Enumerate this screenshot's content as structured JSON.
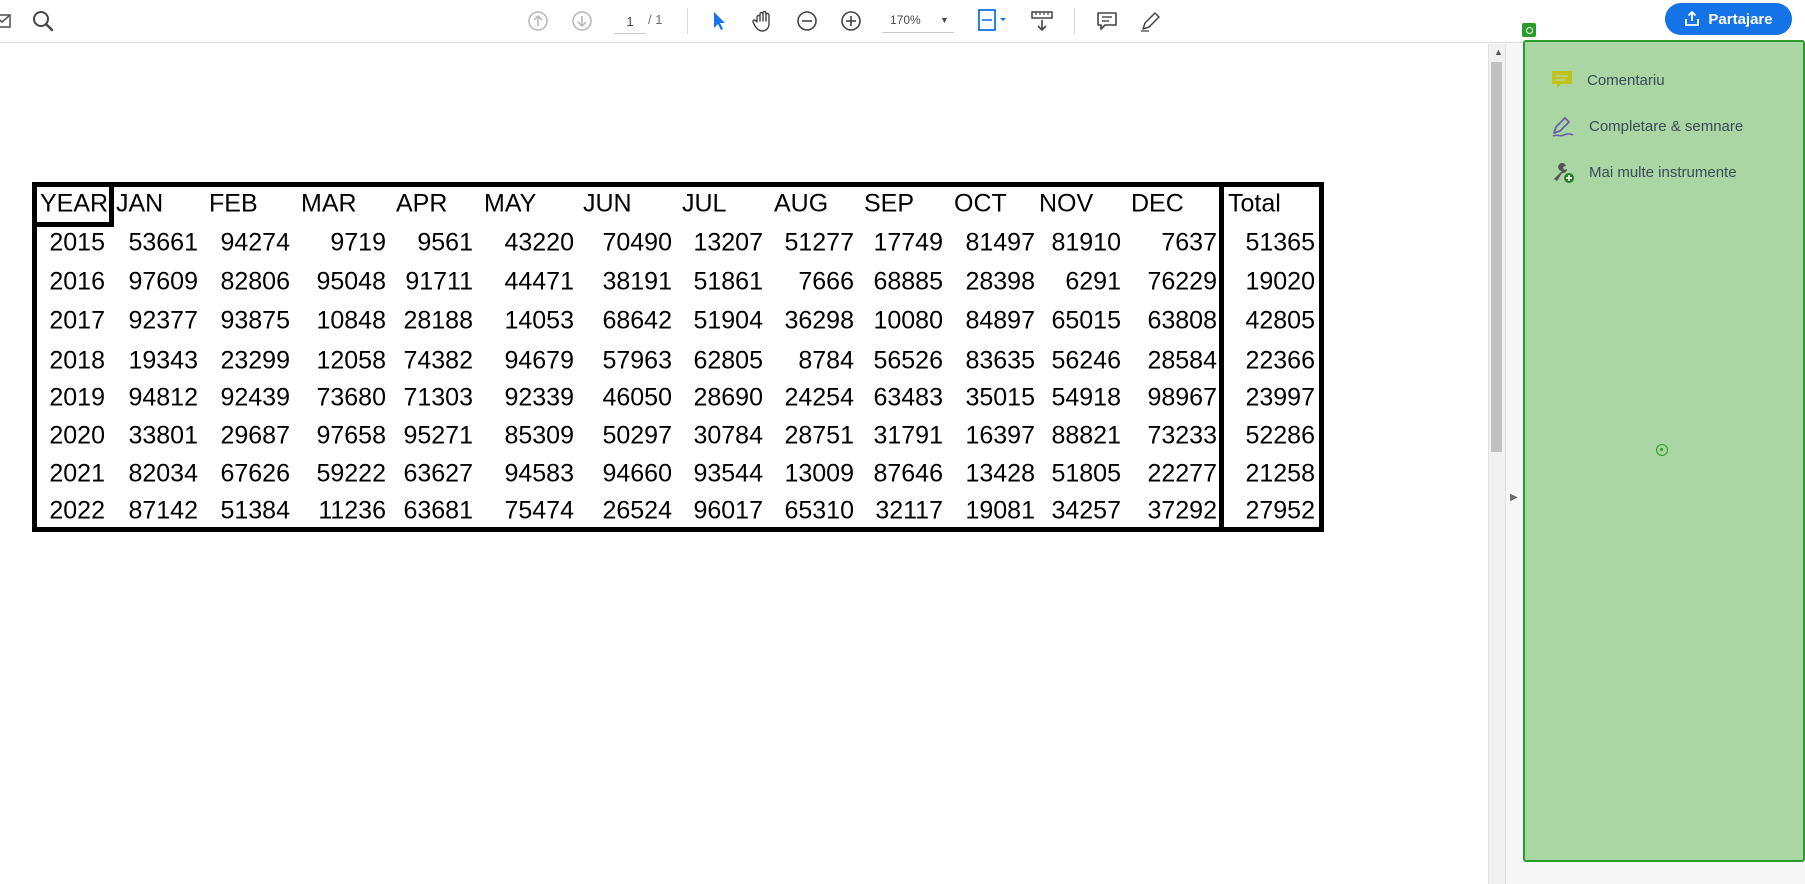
{
  "toolbar": {
    "page_current": "1",
    "page_total": "/ 1",
    "zoom": "170%",
    "share_label": "Partajare"
  },
  "table": {
    "headers": [
      "YEAR",
      "JAN",
      "FEB",
      "MAR",
      "APR",
      "MAY",
      "JUN",
      "JUL",
      "AUG",
      "SEP",
      "OCT",
      "NOV",
      "DEC",
      "Total"
    ],
    "rows": [
      [
        "2015",
        "53661",
        "94274",
        "9719",
        "9561",
        "43220",
        "70490",
        "13207",
        "51277",
        "17749",
        "81497",
        "81910",
        "7637",
        "51365"
      ],
      [
        "2016",
        "97609",
        "82806",
        "95048",
        "91711",
        "44471",
        "38191",
        "51861",
        "7666",
        "68885",
        "28398",
        "6291",
        "76229",
        "19020"
      ],
      [
        "2017",
        "92377",
        "93875",
        "10848",
        "28188",
        "14053",
        "68642",
        "51904",
        "36298",
        "10080",
        "84897",
        "65015",
        "63808",
        "42805"
      ],
      [
        "2018",
        "19343",
        "23299",
        "12058",
        "74382",
        "94679",
        "57963",
        "62805",
        "8784",
        "56526",
        "83635",
        "56246",
        "28584",
        "22366"
      ],
      [
        "2019",
        "94812",
        "92439",
        "73680",
        "71303",
        "92339",
        "46050",
        "28690",
        "24254",
        "63483",
        "35015",
        "54918",
        "98967",
        "23997"
      ],
      [
        "2020",
        "33801",
        "29687",
        "97658",
        "95271",
        "85309",
        "50297",
        "30784",
        "28751",
        "31791",
        "16397",
        "88821",
        "73233",
        "52286"
      ],
      [
        "2021",
        "82034",
        "67626",
        "59222",
        "63627",
        "94583",
        "94660",
        "93544",
        "13009",
        "87646",
        "13428",
        "51805",
        "22277",
        "21258"
      ],
      [
        "2022",
        "87142",
        "51384",
        "11236",
        "63681",
        "75474",
        "26524",
        "96017",
        "65310",
        "32117",
        "19081",
        "34257",
        "37292",
        "27952"
      ]
    ]
  },
  "tools": [
    {
      "label": "Comentariu",
      "icon": "comment-icon"
    },
    {
      "label": "Completare & semnare",
      "icon": "sign-icon"
    },
    {
      "label": "Mai multe instrumente",
      "icon": "more-tools-icon"
    }
  ],
  "colors": {
    "accent": "#1473e6",
    "pane_bg": "#a9d6a3",
    "pane_border": "#2a9c2a"
  }
}
